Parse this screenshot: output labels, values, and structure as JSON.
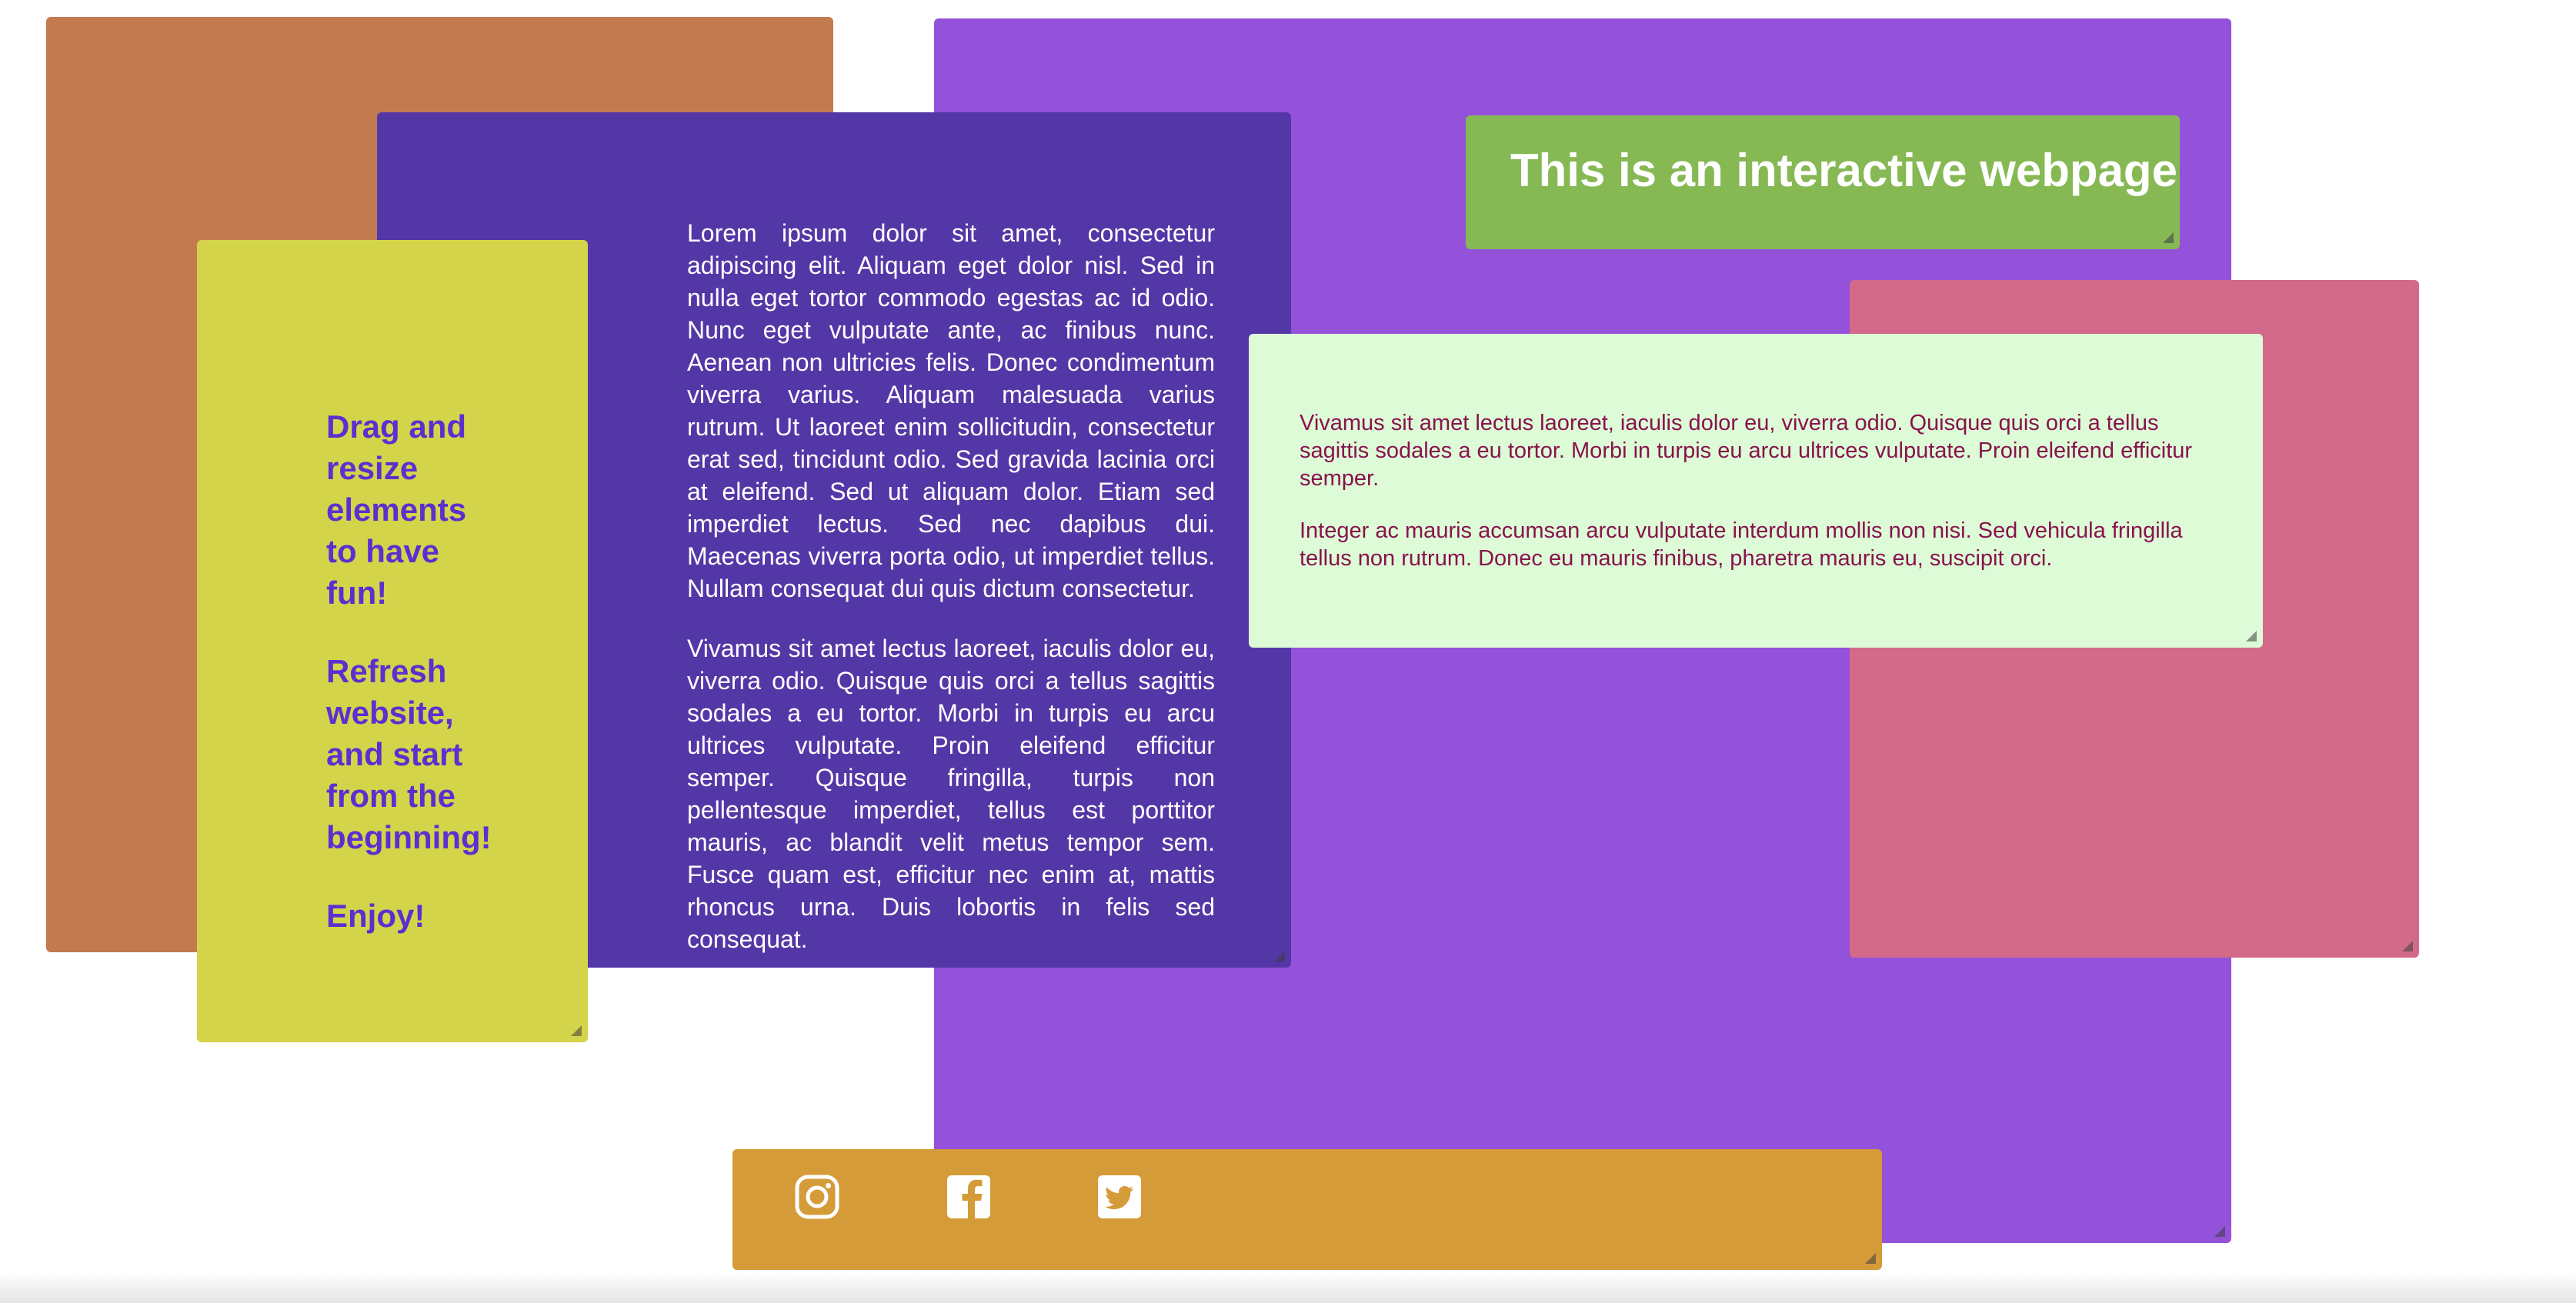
{
  "page": {
    "background": "#ffffff"
  },
  "colors": {
    "orange_panel": "#c47a4f",
    "purple_panel": "#9452db",
    "indigo_panel": "#5337a6",
    "lime_panel": "#d4d44a",
    "green_title_panel": "#86b954",
    "pink_panel": "#d46a8a",
    "mint_panel": "#ddfbd7",
    "footer_bar": "#d49b38",
    "lime_text": "#5c2fd0",
    "mint_text": "#88134d"
  },
  "lime_panel": {
    "line1": "Drag and resize elements to have fun!",
    "line2": "Refresh website, and start from the beginning!",
    "line3": "Enjoy!"
  },
  "indigo_panel": {
    "paragraph1": "Lorem ipsum dolor sit amet, consectetur adipiscing elit. Aliquam eget dolor nisl. Sed in nulla eget tortor commodo egestas ac id odio. Nunc eget vulputate ante, ac finibus nunc. Aenean non ultricies felis. Donec condimentum viverra varius. Aliquam malesuada varius rutrum. Ut laoreet enim sollicitudin, consectetur erat sed, tincidunt odio. Sed gravida lacinia orci at eleifend. Sed ut aliquam dolor. Etiam sed imperdiet lectus. Sed nec dapibus dui. Maecenas viverra porta odio, ut imperdiet tellus. Nullam consequat dui quis dictum consectetur.",
    "paragraph2": "Vivamus sit amet lectus laoreet, iaculis dolor eu, viverra odio. Quisque quis orci a tellus sagittis sodales a eu tortor. Morbi in turpis eu arcu ultrices vulputate. Proin eleifend efficitur semper. Quisque fringilla, turpis non pellentesque imperdiet, tellus est porttitor mauris, ac blandit velit metus tempor sem. Fusce quam est, efficitur nec enim at, mattis rhoncus urna. Duis lobortis in felis sed consequat."
  },
  "title_panel": {
    "title": "This is an interactive webpage"
  },
  "mint_panel": {
    "paragraph1": "Vivamus sit amet lectus laoreet, iaculis dolor eu, viverra odio. Quisque quis orci a tellus sagittis sodales a eu tortor. Morbi in turpis eu arcu ultrices vulputate. Proin eleifend efficitur semper.",
    "paragraph2": "Integer ac mauris accumsan arcu vulputate interdum mollis non nisi. Sed vehicula fringilla tellus non rutrum. Donec eu mauris finibus, pharetra mauris eu, suscipit orci."
  },
  "footer": {
    "icons": [
      "instagram-icon",
      "facebook-icon",
      "twitter-icon"
    ]
  }
}
